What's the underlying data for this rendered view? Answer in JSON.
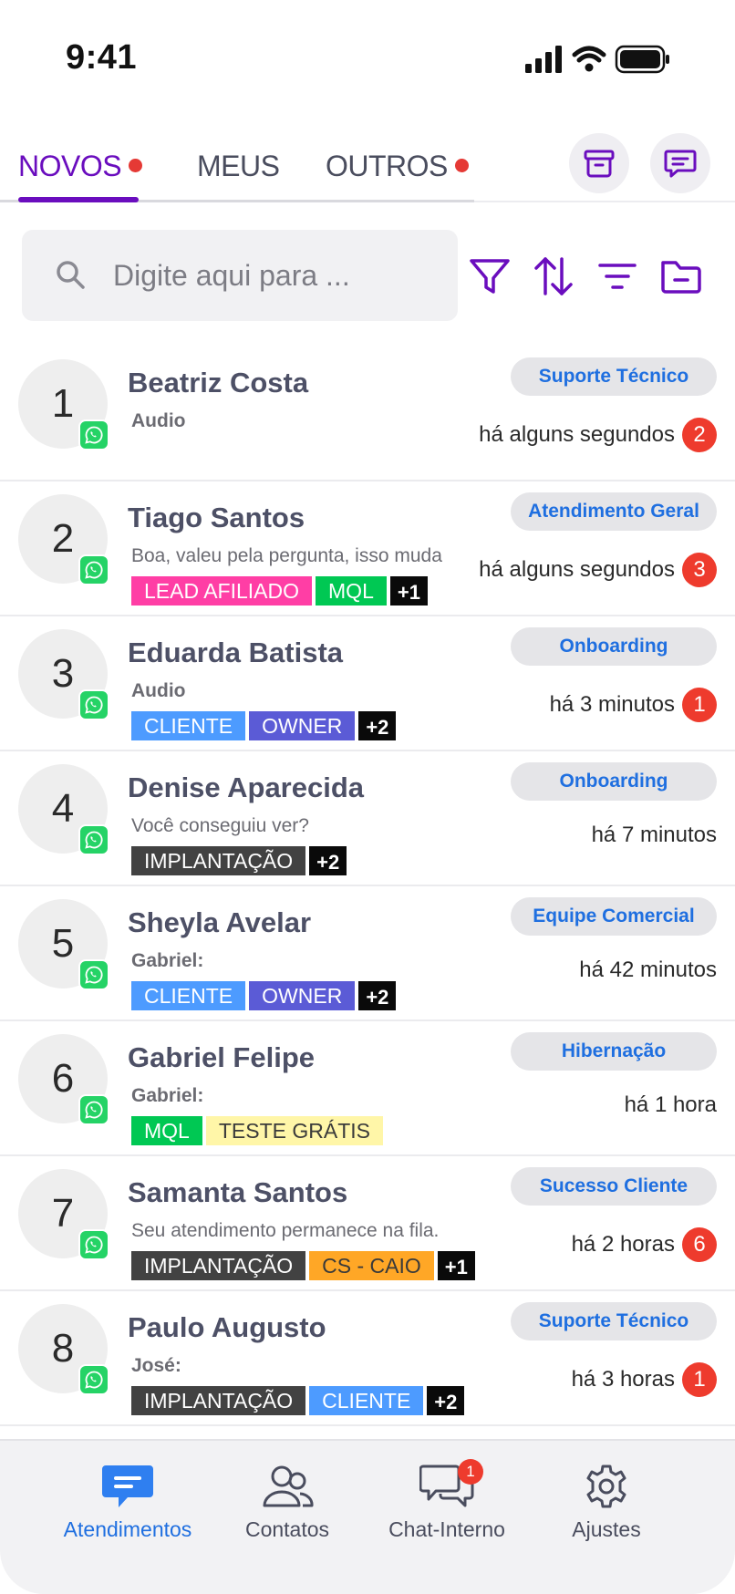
{
  "status_bar": {
    "time": "9:41"
  },
  "tabs": [
    {
      "label": "NOVOS",
      "active": true,
      "has_dot": true
    },
    {
      "label": "MEUS",
      "active": false,
      "has_dot": false
    },
    {
      "label": "OUTROS",
      "active": false,
      "has_dot": true
    }
  ],
  "header_actions": {
    "archive_icon": "archive-icon",
    "chat_icon": "chat-bubble-icon"
  },
  "search": {
    "placeholder": "Digite aqui para ..."
  },
  "toolbar": {
    "icons": [
      "filter-icon",
      "sort-icon",
      "list-filter-icon",
      "folder-icon"
    ]
  },
  "colors": {
    "primary": "#6a0dbe",
    "accent_blue": "#1f6fe0",
    "unread": "#ee3b2d",
    "whatsapp": "#25d366"
  },
  "conversations": [
    {
      "number": "1",
      "name": "Beatriz Costa",
      "preview": "Audio",
      "preview_bold": true,
      "tags": [],
      "more": "",
      "queue": "Suporte Técnico",
      "time": "há alguns segundos",
      "unread": "2"
    },
    {
      "number": "2",
      "name": "Tiago Santos",
      "preview": "Boa, valeu pela pergunta, isso muda",
      "preview_bold": false,
      "tags": [
        {
          "label": "LEAD AFILIADO",
          "color": "#ff3ea5"
        },
        {
          "label": "MQL",
          "color": "#00c853"
        }
      ],
      "more": "+1",
      "queue": "Atendimento Geral",
      "time": "há alguns segundos",
      "unread": "3"
    },
    {
      "number": "3",
      "name": "Eduarda Batista",
      "preview": "Audio",
      "preview_bold": true,
      "tags": [
        {
          "label": "CLIENTE",
          "color": "#4d9bff"
        },
        {
          "label": "OWNER",
          "color": "#5b5bd6"
        }
      ],
      "more": "+2",
      "queue": "Onboarding",
      "time": "há 3 minutos",
      "unread": "1"
    },
    {
      "number": "4",
      "name": "Denise Aparecida",
      "preview": "Você conseguiu ver?",
      "preview_bold": false,
      "tags": [
        {
          "label": "IMPLANTAÇÃO",
          "color": "#424242"
        }
      ],
      "more": "+2",
      "queue": "Onboarding",
      "time": "há 7 minutos",
      "unread": ""
    },
    {
      "number": "5",
      "name": "Sheyla Avelar",
      "preview": "Gabriel:",
      "preview_bold": true,
      "tags": [
        {
          "label": "CLIENTE",
          "color": "#4d9bff"
        },
        {
          "label": "OWNER",
          "color": "#5b5bd6"
        }
      ],
      "more": "+2",
      "queue": "Equipe Comercial",
      "time": "há 42 minutos",
      "unread": ""
    },
    {
      "number": "6",
      "name": "Gabriel Felipe",
      "preview": "Gabriel:",
      "preview_bold": true,
      "tags": [
        {
          "label": "MQL",
          "color": "#00c853"
        },
        {
          "label": "TESTE GRÁTIS",
          "color": "#fff6a8",
          "text_color": "#3a3a3a"
        }
      ],
      "more": "",
      "queue": "Hibernação",
      "time": "há 1 hora",
      "unread": ""
    },
    {
      "number": "7",
      "name": "Samanta Santos",
      "preview": "Seu atendimento permanece na fila.",
      "preview_bold": false,
      "tags": [
        {
          "label": "IMPLANTAÇÃO",
          "color": "#424242"
        },
        {
          "label": "CS - CAIO",
          "color": "#ffa726",
          "text_color": "#3a3a3a"
        }
      ],
      "more": "+1",
      "queue": "Sucesso Cliente",
      "time": "há 2 horas",
      "unread": "6"
    },
    {
      "number": "8",
      "name": "Paulo Augusto",
      "preview": "José:",
      "preview_bold": true,
      "tags": [
        {
          "label": "IMPLANTAÇÃO",
          "color": "#424242"
        },
        {
          "label": "CLIENTE",
          "color": "#4d9bff"
        }
      ],
      "more": "+2",
      "queue": "Suporte Técnico",
      "time": "há 3 horas",
      "unread": "1"
    }
  ],
  "bottom_nav": [
    {
      "label": "Atendimentos",
      "icon": "chat-lines-icon",
      "active": true,
      "badge": ""
    },
    {
      "label": "Contatos",
      "icon": "contacts-icon",
      "active": false,
      "badge": ""
    },
    {
      "label": "Chat-Interno",
      "icon": "internal-chat-icon",
      "active": false,
      "badge": "1"
    },
    {
      "label": "Ajustes",
      "icon": "settings-icon",
      "active": false,
      "badge": ""
    }
  ]
}
